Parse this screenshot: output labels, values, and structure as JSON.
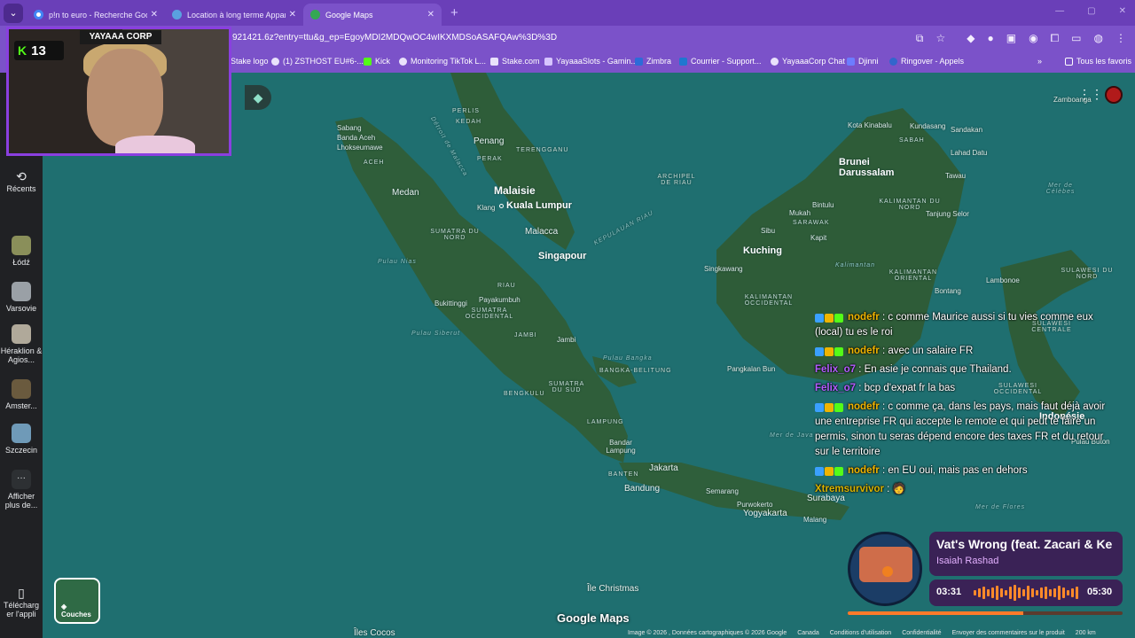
{
  "browser": {
    "tabs": [
      {
        "title": "p!n to euro - Recherche Google",
        "favicon_color": "#4285f4",
        "active": false
      },
      {
        "title": "Location à long terme Appartem",
        "favicon_color": "#5aa0e0",
        "active": false
      },
      {
        "title": "Google Maps",
        "favicon_color": "#34a853",
        "active": true
      }
    ],
    "new_tab_glyph": "+",
    "url": "921421.6z?entry=ttu&g_ep=EgoyMDI2MDQwOC4wIKXMDSoASAFQAw%3D%3D",
    "bookmarks": [
      {
        "label": "Stake logo",
        "icon": "bookmark-icon"
      },
      {
        "label": "(1) ZSTHOST EU#6-...",
        "icon": "bookmark-icon"
      },
      {
        "label": "Kick",
        "icon": "kick-icon"
      },
      {
        "label": "Monitoring TikTok L...",
        "icon": "bookmark-icon"
      },
      {
        "label": "Stake.com",
        "icon": "bookmark-icon"
      },
      {
        "label": "YayaaaSlots - Gamin...",
        "icon": "bookmark-icon"
      },
      {
        "label": "Zimbra",
        "icon": "bookmark-icon"
      },
      {
        "label": "Courrier - Support...",
        "icon": "bookmark-icon"
      },
      {
        "label": "YayaaaCorp Chat",
        "icon": "bookmark-icon"
      },
      {
        "label": "Djinni",
        "icon": "bookmark-icon"
      },
      {
        "label": "Ringover - Appels",
        "icon": "bookmark-icon"
      }
    ],
    "more_bookmarks_glyph": "»",
    "all_bookmarks": "Tous les favoris"
  },
  "maps": {
    "rail": [
      {
        "label": "Récents",
        "icon": "history-icon"
      },
      {
        "label": "Łódź",
        "icon": "place-thumb",
        "color": "#8a8f5a"
      },
      {
        "label": "Varsovie",
        "icon": "place-thumb",
        "color": "#9aa0a6"
      },
      {
        "label": "Héraklion & Agios...",
        "icon": "place-thumb",
        "color": "#b0a99a"
      },
      {
        "label": "Amster...",
        "icon": "place-thumb",
        "color": "#6a5a3e"
      },
      {
        "label": "Szczecin",
        "icon": "place-thumb",
        "color": "#6f9ab8"
      },
      {
        "label": "Afficher plus de...",
        "icon": "more-icon"
      },
      {
        "label": "Télécharg er l'appli",
        "icon": "phone-icon"
      }
    ],
    "layers_label": "Couches",
    "logo": "Google Maps",
    "footer": [
      "Image © 2026 , Données cartographiques © 2026 Google",
      "Canada",
      "Conditions d'utilisation",
      "Confidentialité",
      "Envoyer des commentaires sur le produit",
      "200 km"
    ],
    "labels": {
      "malaisie": "Malaisie",
      "kuala_lumpur": "Kuala Lumpur",
      "singapour": "Singapour",
      "penang": "Penang",
      "medan": "Medan",
      "malacca": "Malacca",
      "brunei": "Brunei Darussalam",
      "kuching": "Kuching",
      "indonesie": "Indonésie",
      "jakarta": "Jakarta",
      "bandung": "Bandung",
      "yogyakarta": "Yogyakarta",
      "surabaya": "Surabaya",
      "semarang": "Semarang",
      "ile_christmas": "Île Christmas",
      "iles_cocos": "Îles Cocos",
      "sabang": "Sabang",
      "banda_aceh": "Banda Aceh",
      "lhokseumawe": "Lhokseumawe",
      "aceh": "ACEH",
      "perlis": "PERLIS",
      "kedah": "KEDAH",
      "perak": "PERAK",
      "terengganu": "TERENGGANU",
      "klang": "Klang",
      "sumatra_nord": "SUMATRA DU NORD",
      "pulau_nias": "Pulau Nias",
      "riau": "RIAU",
      "bukittinggi": "Bukittinggi",
      "payakumbuh": "Payakumbuh",
      "sumatra_ouest": "SUMATRA OCCIDENTAL",
      "pulau_siberut": "Pulau Siberut",
      "jambi_region": "JAMBI",
      "jambi": "Jambi",
      "bengkulu": "BENGKULU",
      "sumatra_sud": "SUMATRA DU SUD",
      "lampung": "LAMPUNG",
      "bandar_lampung": "Bandar Lampung",
      "banten": "BANTEN",
      "purwokerto": "Purwokerto",
      "malang": "Malang",
      "pulau_bangka": "Pulau Bangka",
      "bangka_belitung": "BANGKA-BELITUNG",
      "kepulauan_riau": "KEPULAUAN RIAU",
      "archipel_riau": "ARCHIPEL DE RIAU",
      "detroit_malacca": "Détroit de Malacca",
      "kota_kinabalu": "Kota Kinabalu",
      "kudasang": "Kundasang",
      "sabah": "SABAH",
      "sandakan": "Sandakan",
      "lahad_datu": "Lahad Datu",
      "tawau": "Tawau",
      "bintulu": "Bintulu",
      "mukah": "Mukah",
      "sarawak": "SARAWAK",
      "sibu": "Sibu",
      "kapit": "Kapit",
      "kalimantan_nord": "KALIMANTAN DU NORD",
      "tanjung_selor": "Tanjung Selor",
      "singkawang": "Singkawang",
      "kalimantan_mt": "Kalimantan",
      "kalimantan_est": "KALIMANTAN ORIENTAL",
      "kalimantan_ouest": "KALIMANTAN OCCIDENTAL",
      "bontang": "Bontang",
      "lambonoe": "Lambonoe",
      "sulawesi_nord": "SULAWESI DU NORD",
      "sulawesi_centrale": "SULAWESI CENTRALE",
      "sulawesi_ouest": "SULAWESI OCCIDENTAL",
      "pangkalan_bun": "Pangkalan Bun",
      "mer_celebes": "Mer de Célèbes",
      "mer_java": "Mer de Java",
      "mer_flores": "Mer de Flores",
      "zamboanga": "Zamboanga",
      "butung": "Pulau Buton"
    }
  },
  "stream": {
    "channel": "YAYAAA CORP",
    "viewer_count": "13",
    "chat": [
      {
        "user": "nodefr",
        "user_class": "u1",
        "badges": true,
        "text": "c comme Maurice aussi si tu vies comme eux (local) tu es le roi"
      },
      {
        "user": "nodefr",
        "user_class": "u1",
        "badges": true,
        "text": "avec un salaire FR"
      },
      {
        "user": "Felix_o7",
        "user_class": "u2",
        "badges": false,
        "text": "En asie je connais que Thailand."
      },
      {
        "user": "Felix_o7",
        "user_class": "u2",
        "badges": false,
        "text": "bcp d'expat fr la bas"
      },
      {
        "user": "nodefr",
        "user_class": "u1",
        "badges": true,
        "text": "c comme ça, dans les pays, mais faut déjà avoir une entreprise FR qui accepte le remote et qui peut te faire un permis, sinon tu seras dépend encore des taxes FR et du retour sur le territoire"
      },
      {
        "user": "nodefr",
        "user_class": "u1",
        "badges": true,
        "text": "en EU oui, mais pas en dehors"
      },
      {
        "user": "Xtremsurvivor",
        "user_class": "u3",
        "badges": false,
        "text": "🧑"
      }
    ],
    "music": {
      "song": "Vat's Wrong (feat. Zacari & Ke",
      "artist": "Isaiah Rashad",
      "time_current": "03:31",
      "time_total": "05:30",
      "progress": 0.64
    }
  },
  "colors": {
    "browser_purple": "#7b52c9",
    "tab_strip": "#6a3fb8",
    "sea": "#1f6f70",
    "land": "#2d5a3a"
  }
}
